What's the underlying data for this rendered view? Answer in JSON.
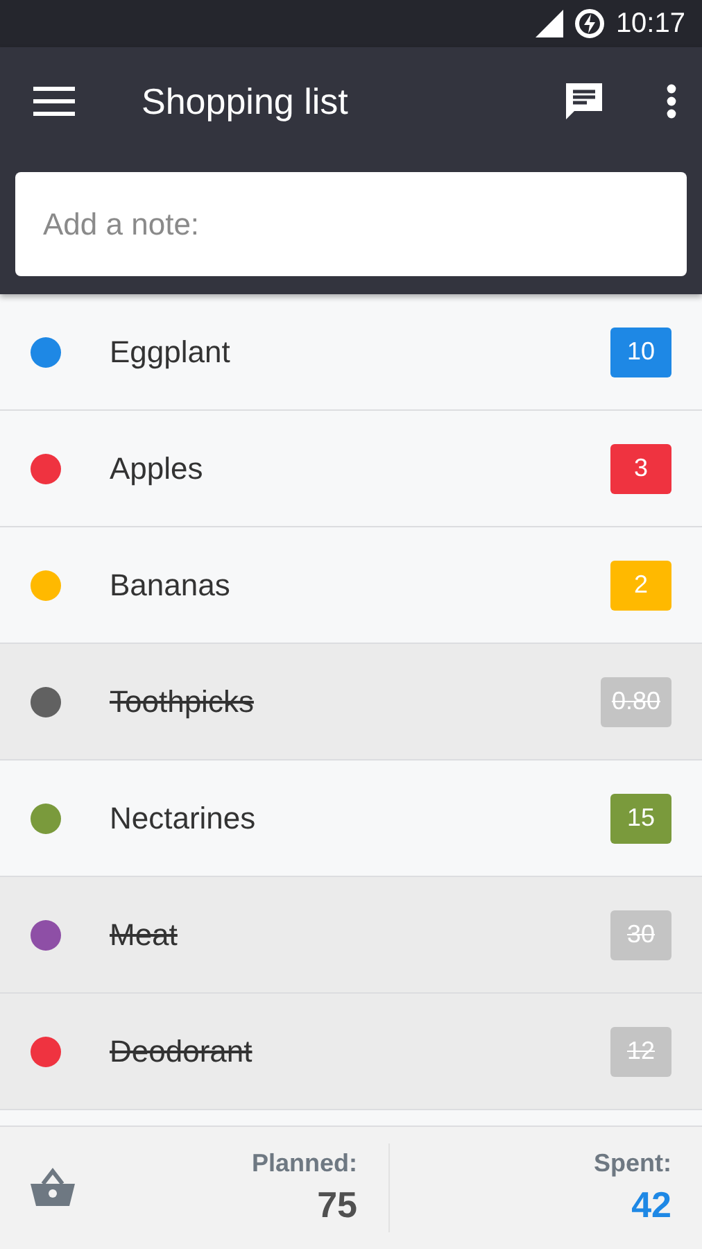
{
  "status_bar": {
    "time": "10:17"
  },
  "toolbar": {
    "title": "Shopping list"
  },
  "note": {
    "placeholder": "Add a note:"
  },
  "items": [
    {
      "name": "Eggplant",
      "color": "#1e88e5",
      "amount": "10",
      "checked": false
    },
    {
      "name": "Apples",
      "color": "#ef3340",
      "amount": "3",
      "checked": false
    },
    {
      "name": "Bananas",
      "color": "#ffb900",
      "amount": "2",
      "checked": false
    },
    {
      "name": "Toothpicks",
      "color": "#616161",
      "amount": "0.80",
      "checked": true
    },
    {
      "name": "Nectarines",
      "color": "#7a9a3c",
      "amount": "15",
      "checked": false
    },
    {
      "name": "Meat",
      "color": "#8e4fa6",
      "amount": "30",
      "checked": true
    },
    {
      "name": "Deodorant",
      "color": "#ef3340",
      "amount": "12",
      "checked": true
    }
  ],
  "footer": {
    "planned_label": "Planned:",
    "planned": "75",
    "spent_label": "Spent:",
    "spent": "42"
  }
}
